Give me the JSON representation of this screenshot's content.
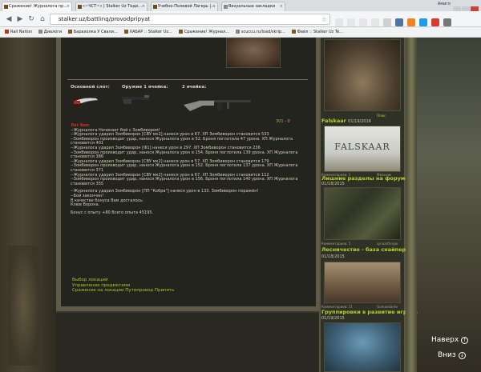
{
  "browser": {
    "tabs": [
      {
        "label": "Сражение! Журналога пр…",
        "active": true
      },
      {
        "label": "«~ЧСТ~» | Stalker Uz Теди…",
        "active": false
      },
      {
        "label": "Учебно-Полевой Лагерь |…",
        "active": false
      },
      {
        "label": "Визуальные закладки",
        "active": false
      }
    ],
    "user": "Амиго",
    "url": "stalker.uz/battlinq/provodpripyat"
  },
  "bookmarks": [
    {
      "label": "Rail Nation"
    },
    {
      "label": "Диалоги"
    },
    {
      "label": "Барахолка У Свали…"
    },
    {
      "label": "ХАБАР :: Stalker Uz…"
    },
    {
      "label": "Сражение! Журнал…"
    },
    {
      "label": "scuccu.ru/load/skrip…"
    },
    {
      "label": "Файл :: Stalker Uz Te…"
    }
  ],
  "slots": {
    "main_label": "Основной слот:",
    "weapon1_label": "Оружие 1 ячейка:",
    "weapon2_label": "2 ячейка:",
    "ammo": "301 - 0"
  },
  "battle_log": {
    "header": "Лог боя:",
    "lines": [
      "--Журналога Начинает бой с Зомбивором!",
      "--Журналога ударил Зомбиворон [СВУ мк2] нанеся урон в 67. ХП Зомбиворон становится 533",
      "--Зомбиворон производит удар, нанося Журналога урон в 52. Броня поглотила 47 урона. ХП Журналога становится 401",
      "--Журналога ударил Зомбиворон [Ф1] нанеся урон в 297. ХП Зомбиворон становится 236",
      "--Зомбиворон производит удар, нанося Журналога урон в 154. Броня поглотила 139 урона. ХП Журналога становится 386",
      "--Журналога ударил Зомбиворон [СВУ мк2] нанеся урон в 57. ХП Зомбиворон становится 179",
      "--Зомбиворон производит удар, нанося Журналога урон в 152. Броня поглотила 137 урона. ХП Журналога становится 371",
      "--Журналога ударил Зомбиворон [СВУ мк2] нанеся урон в 67. ХП Зомбиворон становится 112",
      "--Зомбиворон производит удар, нанося Журналога урон в 156. Броня поглотила 140 урона. ХП Журналога становится 355",
      "",
      "--Журналога ударил Зомбиворон [ПП \"Кобра\"] нанеся урон в 133. Зомбиворон поражён!",
      "--Бой закончен!",
      "В качестве бонуса Вам досталось:",
      "Клюв Ворона.",
      "",
      "Бонус с опыту +80 Всего опыта 45195."
    ]
  },
  "actions": {
    "choose_location": "Выбор локаций",
    "manage_items": "Управление предметами",
    "fight_location": "Сражение на локации Путепровод Припять"
  },
  "sidebar": {
    "top_caption": "Плюс",
    "items": [
      {
        "title": "Falskaar",
        "date": "01/19/2016",
        "meta_left": "Комментариев: 1",
        "meta_right": "Мельник",
        "image_text": "FALSKAAR"
      },
      {
        "title": "Лишние разделы на форуме",
        "date": "01/18/2015",
        "meta_left": "Комментариев: 5",
        "meta_right": "Lynxarthrope"
      },
      {
        "title": "Лесничество - база снайперов",
        "date": "01/18/2015",
        "meta_left": "Комментариев: 11",
        "meta_right": "Gomandante"
      },
      {
        "title": "Группировки в развитие игрока",
        "date": "01/19/2015",
        "meta_left": "",
        "meta_right": ""
      }
    ]
  },
  "float_nav": {
    "up_label": "Наверх",
    "down_label": "Вниз"
  },
  "colors": {
    "link_green": "#aac030",
    "log_text": "#d3cfbd",
    "log_header": "#d0311f",
    "sidebar_title": "#b4d22a"
  }
}
